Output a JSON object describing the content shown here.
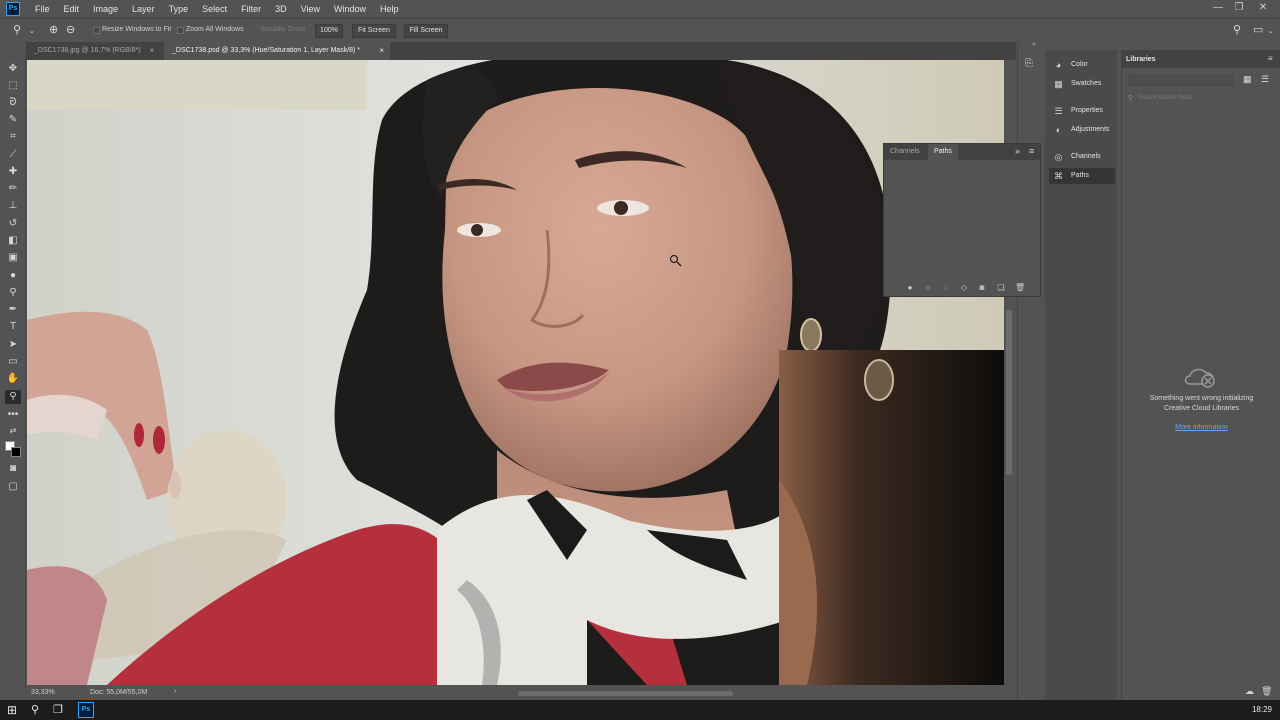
{
  "app": {
    "logo": "Ps"
  },
  "menu": [
    "File",
    "Edit",
    "Image",
    "Layer",
    "Type",
    "Select",
    "Filter",
    "3D",
    "View",
    "Window",
    "Help"
  ],
  "options": {
    "resize_windows": "Resize Windows to Fit",
    "zoom_all": "Zoom All Windows",
    "scrubby_zoom": "Scrubby Zoom",
    "zoom_value": "100%",
    "fit_screen": "Fit Screen",
    "fill_screen": "Fill Screen"
  },
  "tabs": [
    {
      "label": "_DSC1738.jpg @ 16,7% (RGB/8*)",
      "close": "×",
      "active": false
    },
    {
      "label": "_DSC1738.psd @ 33,3% (Hue/Saturation 1, Layer Mask/8) *",
      "close": "×",
      "active": true
    }
  ],
  "status": {
    "zoom": "33,33%",
    "doc": "Doc: 55,0M/55,0M",
    "arrow": "›"
  },
  "panel_strip": [
    {
      "label": "Color",
      "icon": "color-icon",
      "glyph": "◕"
    },
    {
      "label": "Swatches",
      "icon": "swatches-icon",
      "glyph": "▦"
    },
    {
      "label": "Properties",
      "icon": "properties-icon",
      "glyph": "☰"
    },
    {
      "label": "Adjustments",
      "icon": "adjustments-icon",
      "glyph": "◐"
    },
    {
      "label": "Channels",
      "icon": "channels-icon",
      "glyph": "◎"
    },
    {
      "label": "Paths",
      "icon": "paths-icon",
      "glyph": "⌘"
    }
  ],
  "paths_panel": {
    "tabs": [
      "Channels",
      "Paths"
    ],
    "active_tab": "Paths",
    "collapse": "»",
    "menu": "≡"
  },
  "libraries": {
    "title": "Libraries",
    "search_placeholder": "Search Adobe Stock",
    "error_line1": "Something went wrong initializing",
    "error_line2": "Creative Cloud Libraries",
    "link": "More information"
  },
  "taskbar": {
    "time": "18:29"
  },
  "colors": {
    "chrome": "#535353",
    "dark": "#424242",
    "link": "#62a7ff",
    "ps_blue": "#31a8ff"
  }
}
